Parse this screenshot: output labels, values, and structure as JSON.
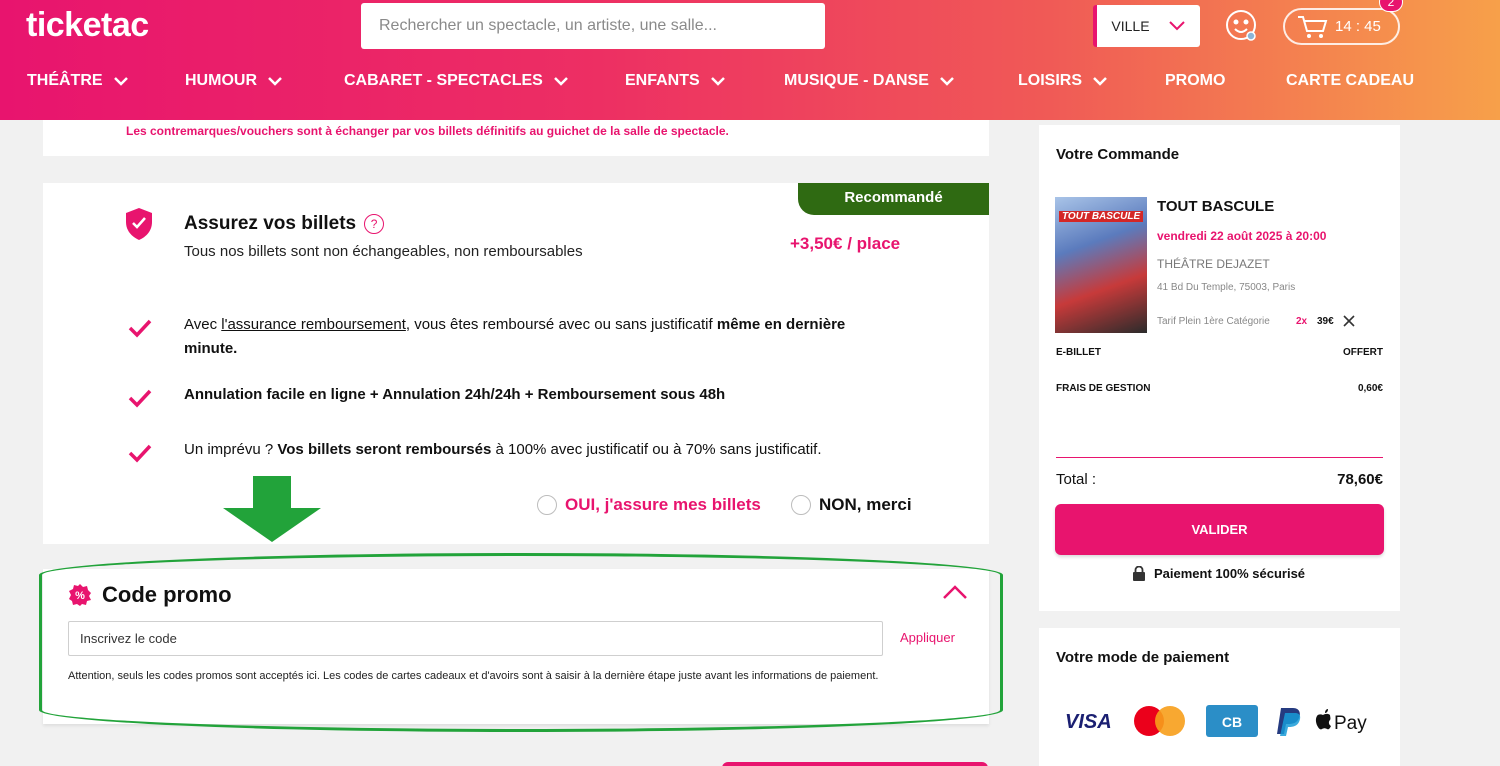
{
  "header": {
    "logo": "ticketac",
    "search_placeholder": "Rechercher un spectacle, un artiste, une salle...",
    "city_label": "VILLE",
    "cart_timer": "14 : 45",
    "cart_count": "2"
  },
  "nav": [
    {
      "label": "THÉÂTRE",
      "has_dropdown": true
    },
    {
      "label": "HUMOUR",
      "has_dropdown": true
    },
    {
      "label": "CABARET - SPECTACLES",
      "has_dropdown": true
    },
    {
      "label": "ENFANTS",
      "has_dropdown": true
    },
    {
      "label": "MUSIQUE - DANSE",
      "has_dropdown": true
    },
    {
      "label": "LOISIRS",
      "has_dropdown": true
    },
    {
      "label": "PROMO",
      "has_dropdown": false
    },
    {
      "label": "CARTE CADEAU",
      "has_dropdown": false
    }
  ],
  "voucher_notice": "Les contremarques/vouchers sont à échanger par vos billets définitifs au guichet de la salle de spectacle.",
  "insurance": {
    "badge": "Recommandé",
    "title": "Assurez vos billets",
    "help": "?",
    "subtitle": "Tous nos billets sont non échangeables, non remboursables",
    "price": "+3,50€ / place",
    "feature1_pre": "Avec ",
    "feature1_link": "l'assurance remboursement",
    "feature1_mid": ", vous êtes remboursé avec ou sans justificatif ",
    "feature1_bold": "même en dernière minute.",
    "feature2": "Annulation facile en ligne + Annulation 24h/24h + Remboursement sous 48h",
    "feature3_pre": "Un imprévu ? ",
    "feature3_bold": "Vos billets seront remboursés",
    "feature3_post": " à 100% avec justificatif ou à 70% sans justificatif.",
    "option_yes": "OUI, j'assure mes billets",
    "option_no": "NON, merci"
  },
  "promo": {
    "title": "Code promo",
    "input_placeholder": "Inscrivez le code",
    "apply_label": "Appliquer",
    "note": "Attention, seuls les codes promos sont acceptés ici. Les codes de cartes cadeaux et d'avoirs sont à saisir à la dernière étape juste avant les informations de paiement."
  },
  "order": {
    "title": "Votre Commande",
    "poster_text": "TOUT BASCULE",
    "show_title": "TOUT BASCULE",
    "date": "vendredi 22 août 2025 à 20:00",
    "venue": "THÉÂTRE DEJAZET",
    "address": "41 Bd Du Temple, 75003, Paris",
    "tarif": "Tarif Plein 1ère Catégorie",
    "quantity": "2x",
    "unit_price": "39€",
    "rows": [
      {
        "label": "E-BILLET",
        "value": "OFFERT"
      },
      {
        "label": "FRAIS DE GESTION",
        "value": "0,60€"
      }
    ],
    "total_label": "Total :",
    "total_value": "78,60€",
    "validate_label": "VALIDER",
    "secure_label": "Paiement 100% sécurisé"
  },
  "payment": {
    "title": "Votre mode de paiement",
    "methods": [
      "VISA",
      "Mastercard",
      "CB",
      "PayPal",
      "Apple Pay"
    ],
    "visa_text": "VISA",
    "cb_text": "CB",
    "applepay_text": "Pay"
  },
  "colors": {
    "brand_pink": "#e8146e",
    "recommended_green": "#2f6a12",
    "highlight_green": "#22a33a"
  }
}
